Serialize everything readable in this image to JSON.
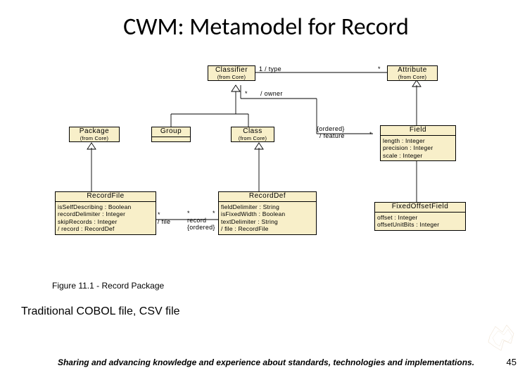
{
  "title": "CWM: Metamodel for Record",
  "boxes": {
    "classifier": {
      "name": "Classifier",
      "from": "(from Core)"
    },
    "attribute": {
      "name": "Attribute",
      "from": "(from Core)"
    },
    "package": {
      "name": "Package",
      "from": "(from Core)"
    },
    "group": {
      "name": "Group"
    },
    "class": {
      "name": "Class",
      "from": "(from Core)"
    },
    "field": {
      "name": "Field",
      "attrs": [
        "length : Integer",
        "precision : Integer",
        "scale : Integer"
      ]
    },
    "recordfile": {
      "name": "RecordFile",
      "attrs": [
        "isSelfDescribing : Boolean",
        "recordDelimiter : Integer",
        "skipRecords : Integer",
        "/ record : RecordDef"
      ]
    },
    "recorddef": {
      "name": "RecordDef",
      "attrs": [
        "fieldDelimiter : String",
        "isFixedWidth : Boolean",
        "textDelimiter : String",
        "/ file : RecordFile"
      ]
    },
    "fixedoffsetfield": {
      "name": "FixedOffsetField",
      "attrs": [
        "offset : Integer",
        "offsetUnitBits : Integer"
      ]
    }
  },
  "labels": {
    "type": "1 / type",
    "owner": "/ owner",
    "star1": "*",
    "star2": "*",
    "ordered_feature": "{ordered}\n/ feature",
    "star3": "*",
    "file": "*\n/ file",
    "record": "*\nrecord\n{ordered}",
    "star4": "*"
  },
  "figure_caption": "Figure 11.1 - Record Package",
  "subtitle": "Traditional COBOL file, CSV file",
  "footer": "Sharing and advancing knowledge and experience about standards, technologies and implementations.",
  "page": "45"
}
